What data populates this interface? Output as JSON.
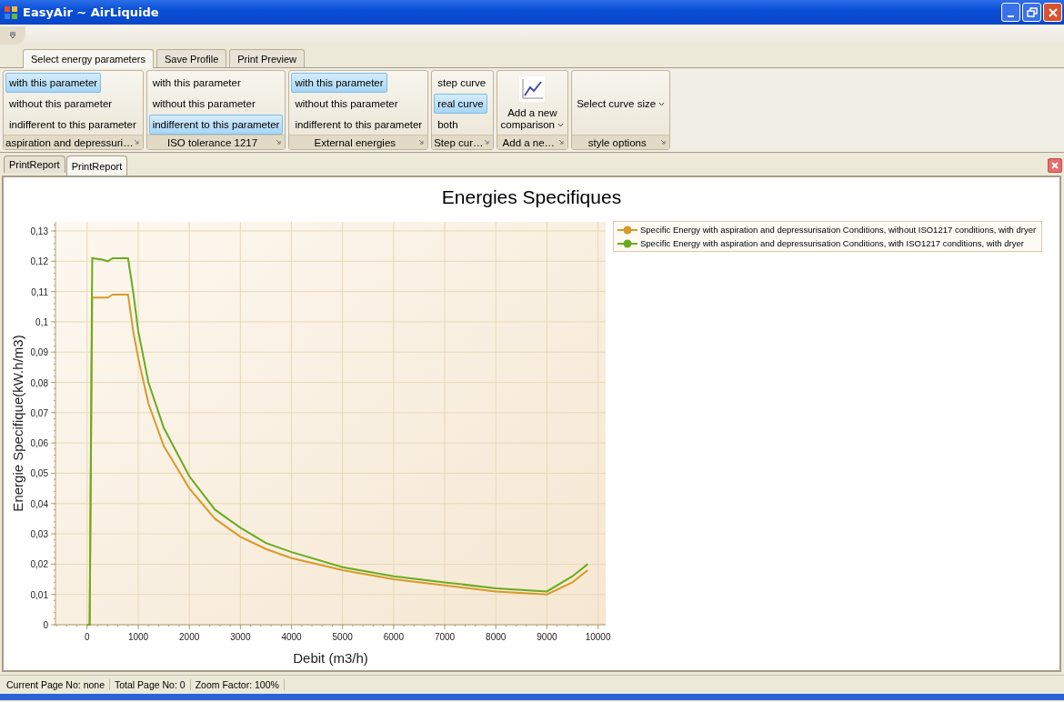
{
  "window": {
    "title": "EasyAir ~ AirLiquide"
  },
  "ribbon_tabs": [
    {
      "label": "Select energy parameters",
      "selected": true
    },
    {
      "label": "Save Profile",
      "selected": false
    },
    {
      "label": "Print Preview",
      "selected": false
    }
  ],
  "ribbon_groups": [
    {
      "kind": "options",
      "label": "aspiration and depressuri…",
      "items": [
        {
          "label": "with this parameter",
          "selected": true
        },
        {
          "label": "without this parameter",
          "selected": false
        },
        {
          "label": "indifferent to this parameter",
          "selected": false
        }
      ]
    },
    {
      "kind": "options",
      "label": "ISO tolerance 1217",
      "items": [
        {
          "label": "with this parameter",
          "selected": false
        },
        {
          "label": "without this parameter",
          "selected": false
        },
        {
          "label": "indifferent to this parameter",
          "selected": true
        }
      ]
    },
    {
      "kind": "options",
      "label": "External energies",
      "items": [
        {
          "label": "with this parameter",
          "selected": true
        },
        {
          "label": "without this parameter",
          "selected": false
        },
        {
          "label": "indifferent to this parameter",
          "selected": false
        }
      ]
    },
    {
      "kind": "options",
      "label": "Step cur…",
      "items": [
        {
          "label": "step curve",
          "selected": false
        },
        {
          "label": "real curve",
          "selected": true
        },
        {
          "label": "both",
          "selected": false
        }
      ]
    },
    {
      "kind": "big_button",
      "label": "Add a ne…",
      "button_lines": [
        "Add a new",
        "comparison"
      ]
    },
    {
      "kind": "dropdown",
      "label": "style options",
      "button": "Select curve size"
    }
  ],
  "document_tabs": [
    {
      "label": "PrintReport",
      "selected": false
    },
    {
      "label": "PrintReport",
      "selected": true
    }
  ],
  "report": {
    "chart_data": {
      "type": "line",
      "title": "Energies Specifiques",
      "xlabel": "Debit (m3/h)",
      "ylabel": "Energie Specifique(kW.h/m3)",
      "x": [
        0,
        50,
        100,
        300,
        400,
        500,
        800,
        900,
        1000,
        1200,
        1500,
        2000,
        2500,
        3000,
        3500,
        4000,
        5000,
        6000,
        7000,
        8000,
        9000,
        9500,
        9800
      ],
      "grid": true,
      "xlim": [
        -620,
        10150
      ],
      "ylim": [
        0,
        0.133
      ],
      "xticks": [
        0,
        1000,
        2000,
        3000,
        4000,
        5000,
        6000,
        7000,
        8000,
        9000,
        10000
      ],
      "yticks": [
        {
          "value": 0,
          "label": "0"
        },
        {
          "value": 0.01,
          "label": "0,01"
        },
        {
          "value": 0.02,
          "label": "0,02"
        },
        {
          "value": 0.03,
          "label": "0,03"
        },
        {
          "value": 0.04,
          "label": "0,04"
        },
        {
          "value": 0.05,
          "label": "0,05"
        },
        {
          "value": 0.06,
          "label": "0,06"
        },
        {
          "value": 0.07,
          "label": "0,07"
        },
        {
          "value": 0.08,
          "label": "0,08"
        },
        {
          "value": 0.09,
          "label": "0,09"
        },
        {
          "value": 0.1,
          "label": "0,1"
        },
        {
          "value": 0.11,
          "label": "0,11"
        },
        {
          "value": 0.12,
          "label": "0,12"
        },
        {
          "value": 0.13,
          "label": "0,13"
        }
      ],
      "series": [
        {
          "name": "Specific Energy with aspiration and depressurisation Conditions, without ISO1217 conditions, with dryer",
          "color": "#d89a2a",
          "values": [
            0,
            0,
            0.108,
            0.108,
            0.108,
            0.109,
            0.109,
            0.097,
            0.088,
            0.073,
            0.059,
            0.045,
            0.035,
            0.029,
            0.025,
            0.022,
            0.018,
            0.015,
            0.013,
            0.011,
            0.01,
            0.014,
            0.018
          ]
        },
        {
          "name": "Specific Energy with aspiration and depressurisation Conditions, with ISO1217 conditions, with dryer",
          "color": "#6aab1e",
          "values": [
            0,
            0,
            0.121,
            0.1205,
            0.12,
            0.121,
            0.121,
            0.11,
            0.097,
            0.08,
            0.065,
            0.049,
            0.038,
            0.032,
            0.027,
            0.024,
            0.019,
            0.016,
            0.014,
            0.012,
            0.011,
            0.016,
            0.02
          ]
        }
      ]
    }
  },
  "status_bar": [
    "Current Page No: none",
    "Total Page No: 0",
    "Zoom Factor: 100%"
  ]
}
